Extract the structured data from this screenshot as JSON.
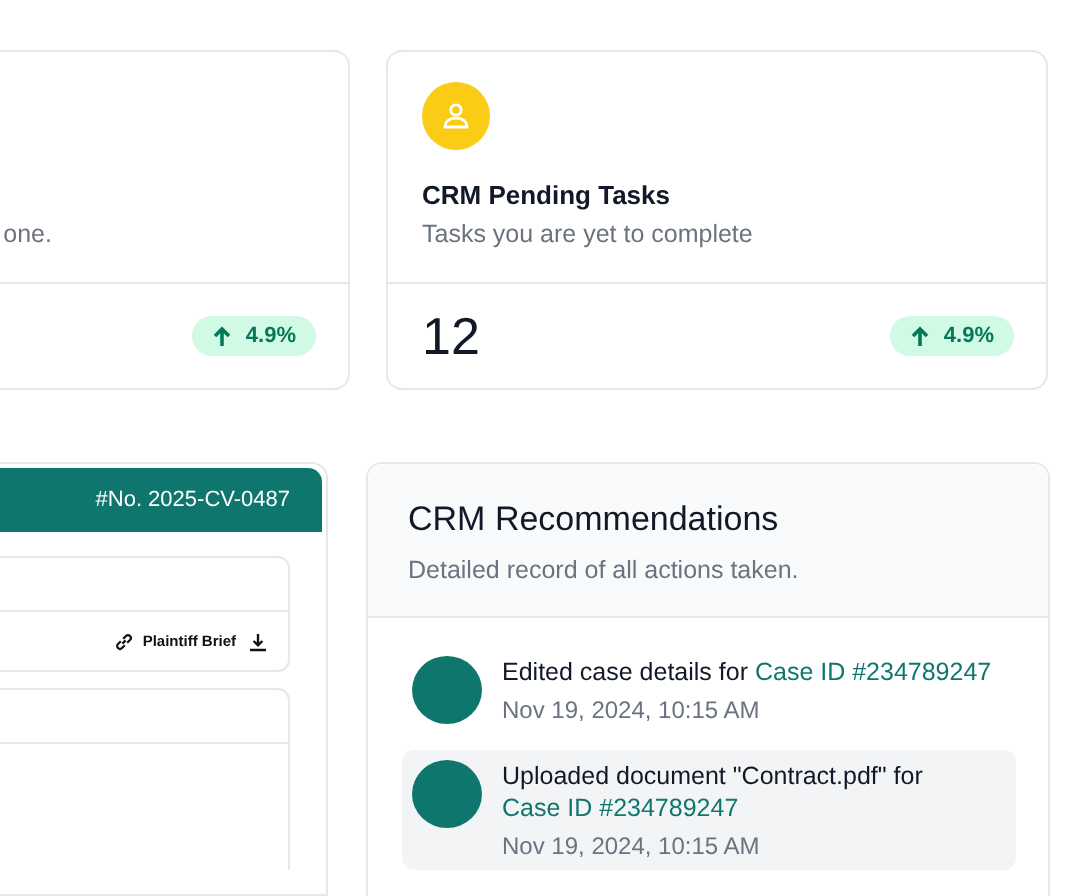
{
  "stat_cards": [
    {
      "description": "one.",
      "badge": "4.9%",
      "icon": false
    },
    {
      "title": "CRM Pending Tasks",
      "description": "Tasks you are yet to complete",
      "value": "12",
      "badge": "4.9%",
      "icon": true
    }
  ],
  "case_panel": {
    "number": "#No. 2025-CV-0487",
    "attachment": "Plaintiff Brief"
  },
  "recommendations": {
    "title": "CRM Recommendations",
    "subtitle": "Detailed record of all actions taken.",
    "items": [
      {
        "text": "Edited case details for ",
        "link": "Case ID #234789247",
        "time": "Nov 19, 2024, 10:15 AM",
        "highlighted": false
      },
      {
        "text": "Uploaded document \"Contract.pdf\" for ",
        "link": "Case ID #234789247",
        "time": "Nov 19, 2024, 10:15 AM",
        "highlighted": true
      }
    ]
  }
}
